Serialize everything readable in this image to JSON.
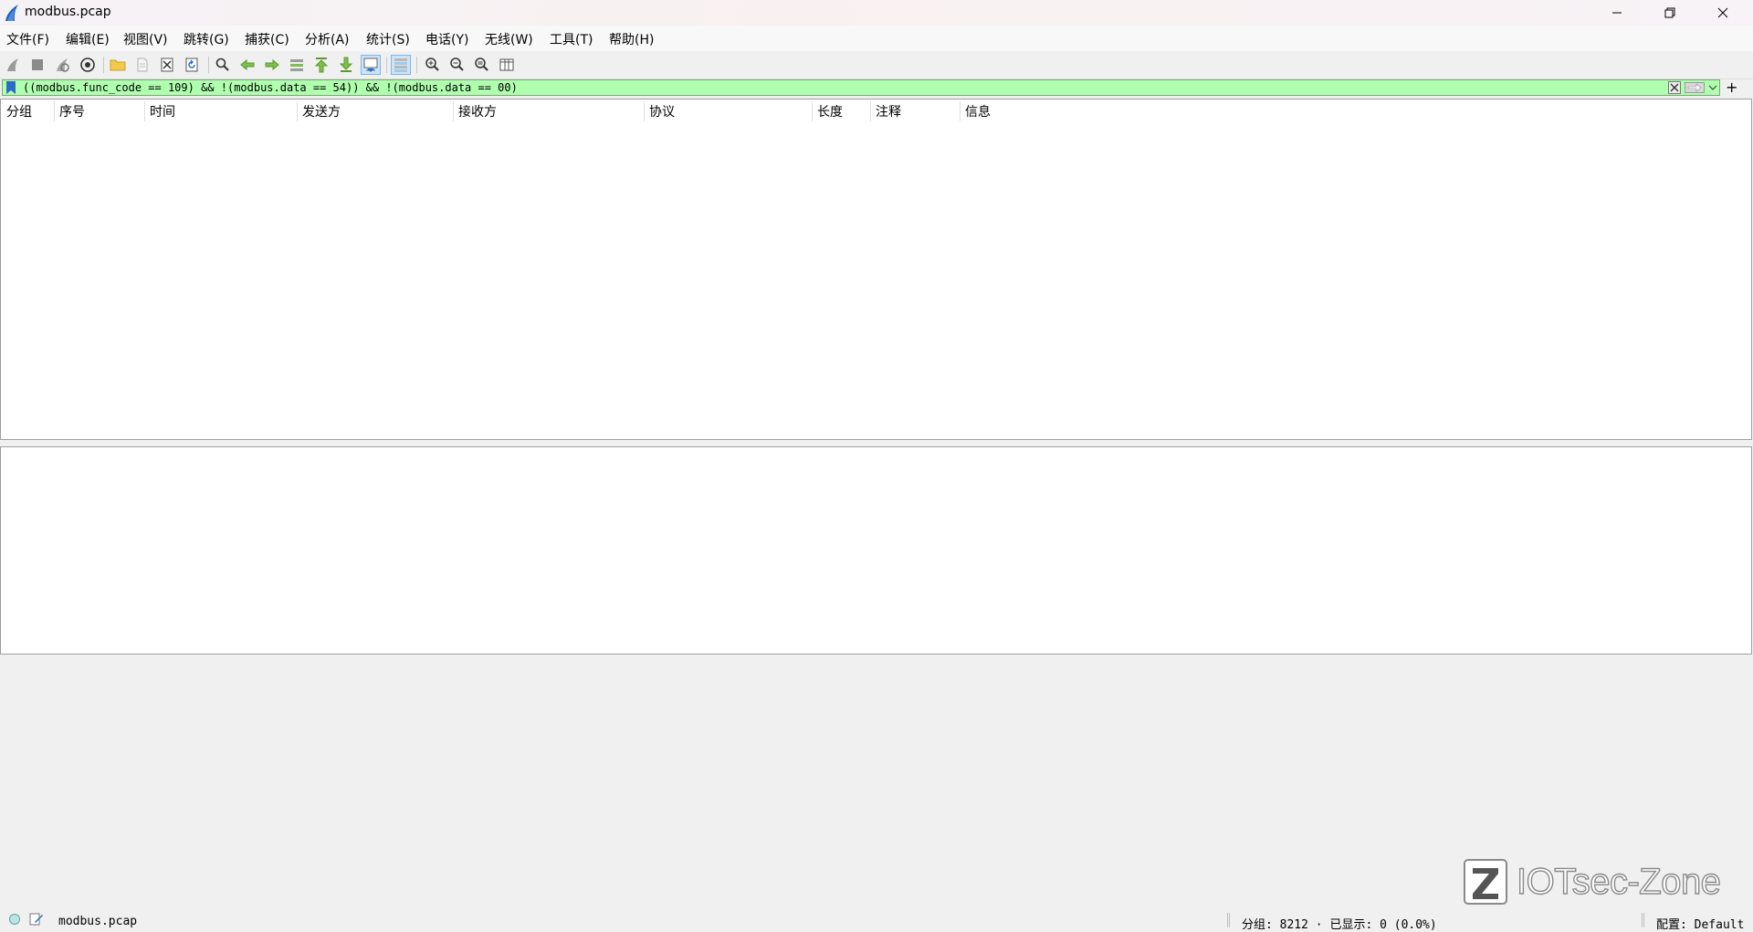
{
  "window": {
    "title": "modbus.pcap"
  },
  "menu": [
    "文件(F)",
    "编辑(E)",
    "视图(V)",
    "跳转(G)",
    "捕获(C)",
    "分析(A)",
    "统计(S)",
    "电话(Y)",
    "无线(W)",
    "工具(T)",
    "帮助(H)"
  ],
  "toolbar": {
    "icons": [
      "start-capture-icon",
      "stop-capture-icon",
      "restart-capture-icon",
      "capture-options-icon",
      "open-file-icon",
      "save-file-icon",
      "close-file-icon",
      "reload-file-icon",
      "find-packet-icon",
      "go-back-icon",
      "go-forward-icon",
      "go-to-packet-icon",
      "first-packet-icon",
      "last-packet-icon",
      "auto-scroll-icon",
      "colorize-icon",
      "zoom-in-icon",
      "zoom-out-icon",
      "zoom-normal-icon",
      "resize-columns-icon"
    ]
  },
  "filter": {
    "expression": "((modbus.func_code == 109) && !(modbus.data == 54)) && !(modbus.data == 00)",
    "background": "#afffaf"
  },
  "packet_list": {
    "columns": [
      "分组",
      "序号",
      "时间",
      "发送方",
      "接收方",
      "协议",
      "长度",
      "注释",
      "信息"
    ],
    "rows": []
  },
  "status": {
    "file": "modbus.pcap",
    "stats": "分组: 8212 · 已显示: 0 (0.0%)",
    "profile": "配置: Default"
  },
  "watermark": {
    "text": "IOTsec-Zone"
  }
}
